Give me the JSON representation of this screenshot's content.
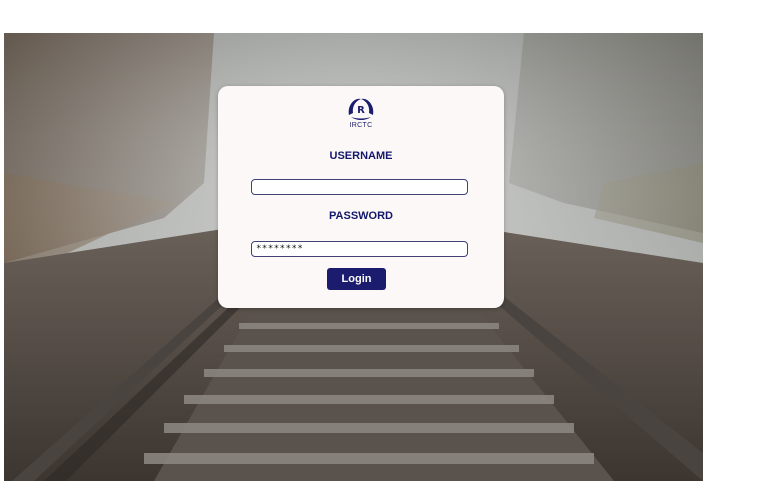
{
  "logo": {
    "icon": "irctc-logo-icon",
    "text": "IRCTC"
  },
  "form": {
    "username_label": "USERNAME",
    "username_value": "",
    "password_label": "PASSWORD",
    "password_value": "********",
    "login_label": "Login"
  },
  "colors": {
    "brand": "#1b1c6e",
    "card": "#fdf8f8"
  }
}
